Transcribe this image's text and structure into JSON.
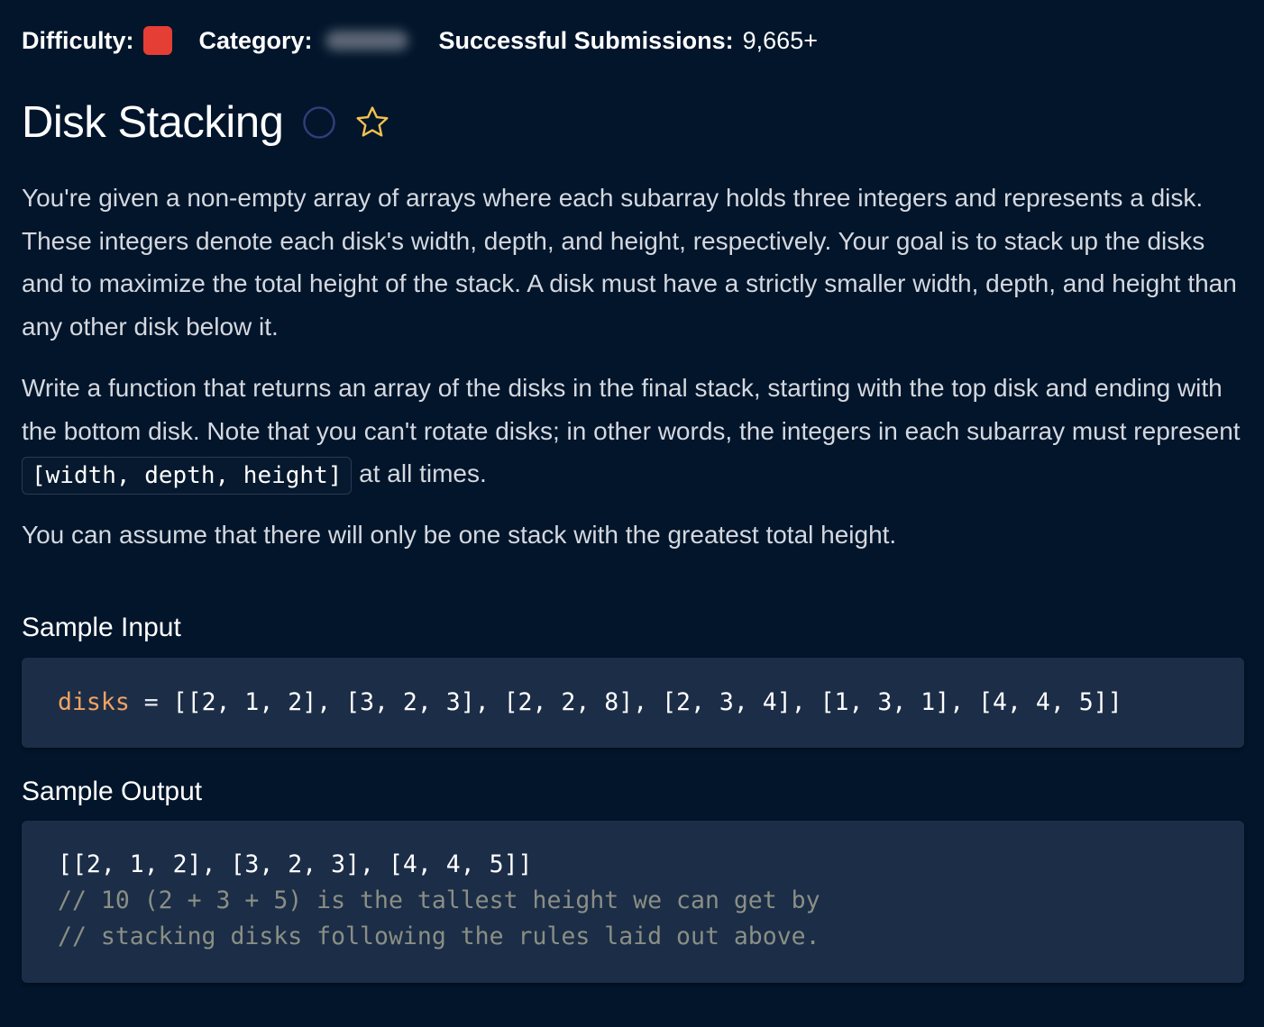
{
  "meta": {
    "difficulty_label": "Difficulty:",
    "difficulty_color": "#e53e35",
    "category_label": "Category:",
    "submissions_label": "Successful Submissions:",
    "submissions_value": "9,665+"
  },
  "header": {
    "title": "Disk Stacking",
    "status_icon": "circle-icon",
    "favorite_icon": "star-icon"
  },
  "description": {
    "paragraph1": "You're given a non-empty array of arrays where each subarray holds three integers and represents a disk. These integers denote each disk's width, depth, and height, respectively. Your goal is to stack up the disks and to maximize the total height of the stack. A disk must have a strictly smaller width, depth, and height than any other disk below it.",
    "paragraph2_before": "Write a function that returns an array of the disks in the final stack, starting with the top disk and ending with the bottom disk. Note that you can't rotate disks; in other words, the integers in each subarray must represent ",
    "paragraph2_code": "[width, depth, height]",
    "paragraph2_after": " at all times.",
    "paragraph3": "You can assume that there will only be one stack with the greatest total height."
  },
  "sample_input": {
    "heading": "Sample Input",
    "variable": "disks",
    "operator": " = ",
    "value": "[[2, 1, 2], [3, 2, 3], [2, 2, 8], [2, 3, 4], [1, 3, 1], [4, 4, 5]]"
  },
  "sample_output": {
    "heading": "Sample Output",
    "line1": "[[2, 1, 2], [3, 2, 3], [4, 4, 5]]",
    "line2": "// 10 (2 + 3 + 5) is the tallest height we can get by",
    "line3": "// stacking disks following the rules laid out above."
  },
  "colors": {
    "background": "#02152b",
    "code_background": "#1c2d47",
    "variable": "#f4a261",
    "comment": "#8a8f85",
    "circle_stroke": "#2f3d7a",
    "star_stroke": "#f2c14e"
  }
}
